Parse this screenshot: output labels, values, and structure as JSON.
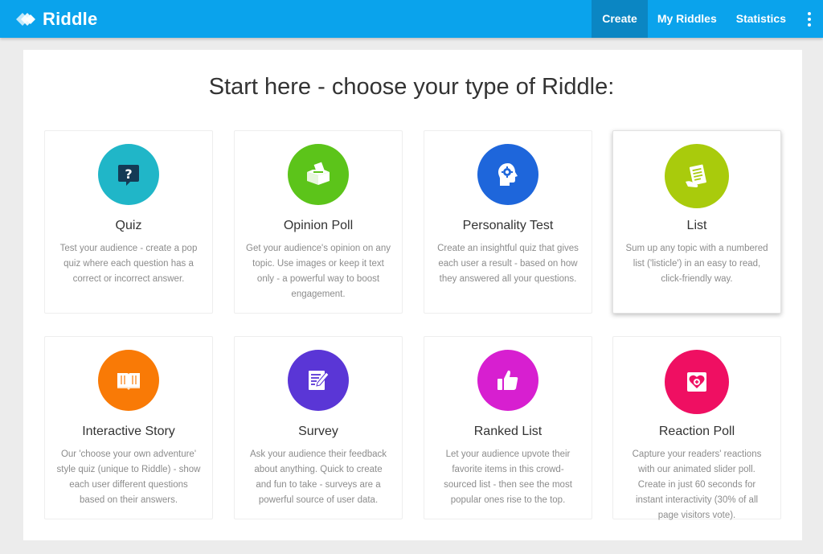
{
  "app": {
    "logo_text": "Riddle",
    "brand_color": "#0aa3ec"
  },
  "nav": {
    "items": [
      {
        "label": "Create",
        "active": true
      },
      {
        "label": "My Riddles",
        "active": false
      },
      {
        "label": "Statistics",
        "active": false
      }
    ],
    "more_icon": "kebab-menu-icon"
  },
  "headline": "Start here - choose your type of Riddle:",
  "cards": [
    {
      "title": "Quiz",
      "icon": "question-bubble-icon",
      "color": "#20b6c8",
      "description": "Test your audience - create a pop quiz where each question has a correct or incorrect answer."
    },
    {
      "title": "Opinion Poll",
      "icon": "ballot-box-icon",
      "color": "#5cc41a",
      "description": "Get your audience's opinion on any topic. Use images or keep it text only - a powerful way to boost engagement."
    },
    {
      "title": "Personality Test",
      "icon": "head-gear-icon",
      "color": "#1e66db",
      "description": "Create an insightful quiz that gives each user a result - based on how they answered all your questions."
    },
    {
      "title": "List",
      "icon": "checklist-hand-icon",
      "color": "#a9cb0c",
      "description": "Sum up any topic with a numbered list ('listicle') in an easy to read, click-friendly way."
    },
    {
      "title": "Interactive Story",
      "icon": "open-book-icon",
      "color": "#f97a06",
      "description": "Our 'choose your own adventure' style quiz (unique to Riddle) - show each user different questions based on their answers."
    },
    {
      "title": "Survey",
      "icon": "pencil-form-icon",
      "color": "#5a36d6",
      "description": "Ask your audience their feedback about anything. Quick to create and fun to take - surveys are a powerful source of user data."
    },
    {
      "title": "Ranked List",
      "icon": "thumbs-up-icon",
      "color": "#d71fd0",
      "description": "Let your audience upvote their favorite items in this crowd-sourced list - then see the most popular ones rise to the top."
    },
    {
      "title": "Reaction Poll",
      "icon": "heart-plus-icon",
      "color": "#ef0f62",
      "description": "Capture your readers' reactions with our animated slider poll. Create in just 60 seconds for instant interactivity (30% of all page visitors vote)."
    }
  ]
}
